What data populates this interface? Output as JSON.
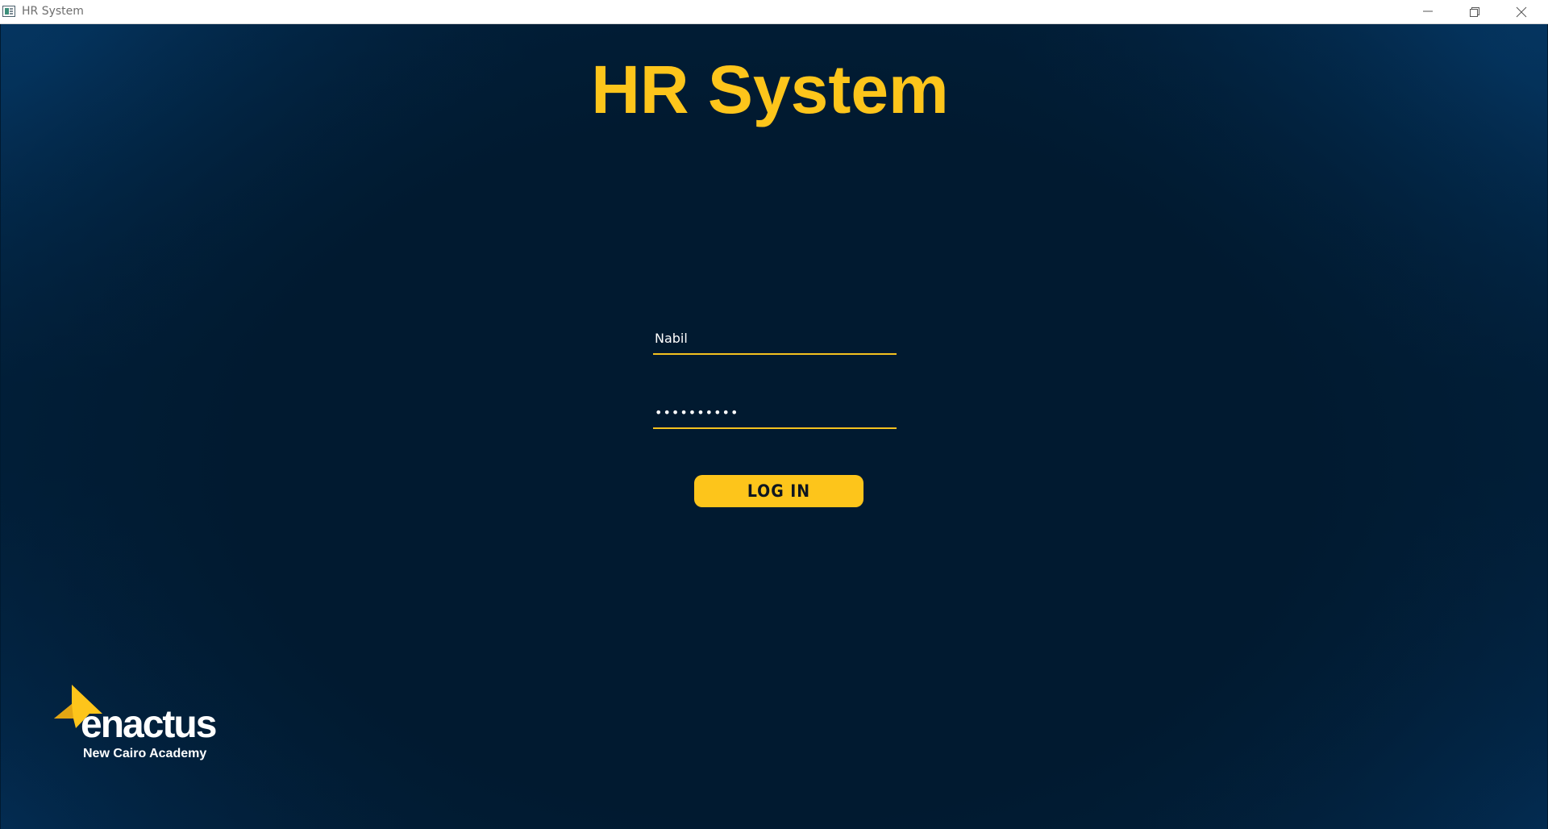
{
  "window": {
    "title": "HR System",
    "controls": {
      "minimize_icon": "minimize-icon",
      "maximize_icon": "restore-icon",
      "close_icon": "close-icon"
    }
  },
  "login": {
    "app_title": "HR System",
    "username_value": "Nabil",
    "password_value": "••••••••••",
    "login_button_label": "LOG IN"
  },
  "logo": {
    "wordmark": "enactus",
    "subtitle": "New Cairo Academy"
  },
  "colors": {
    "accent": "#fdc51b",
    "background": "#011a30",
    "text": "#ffffff"
  }
}
